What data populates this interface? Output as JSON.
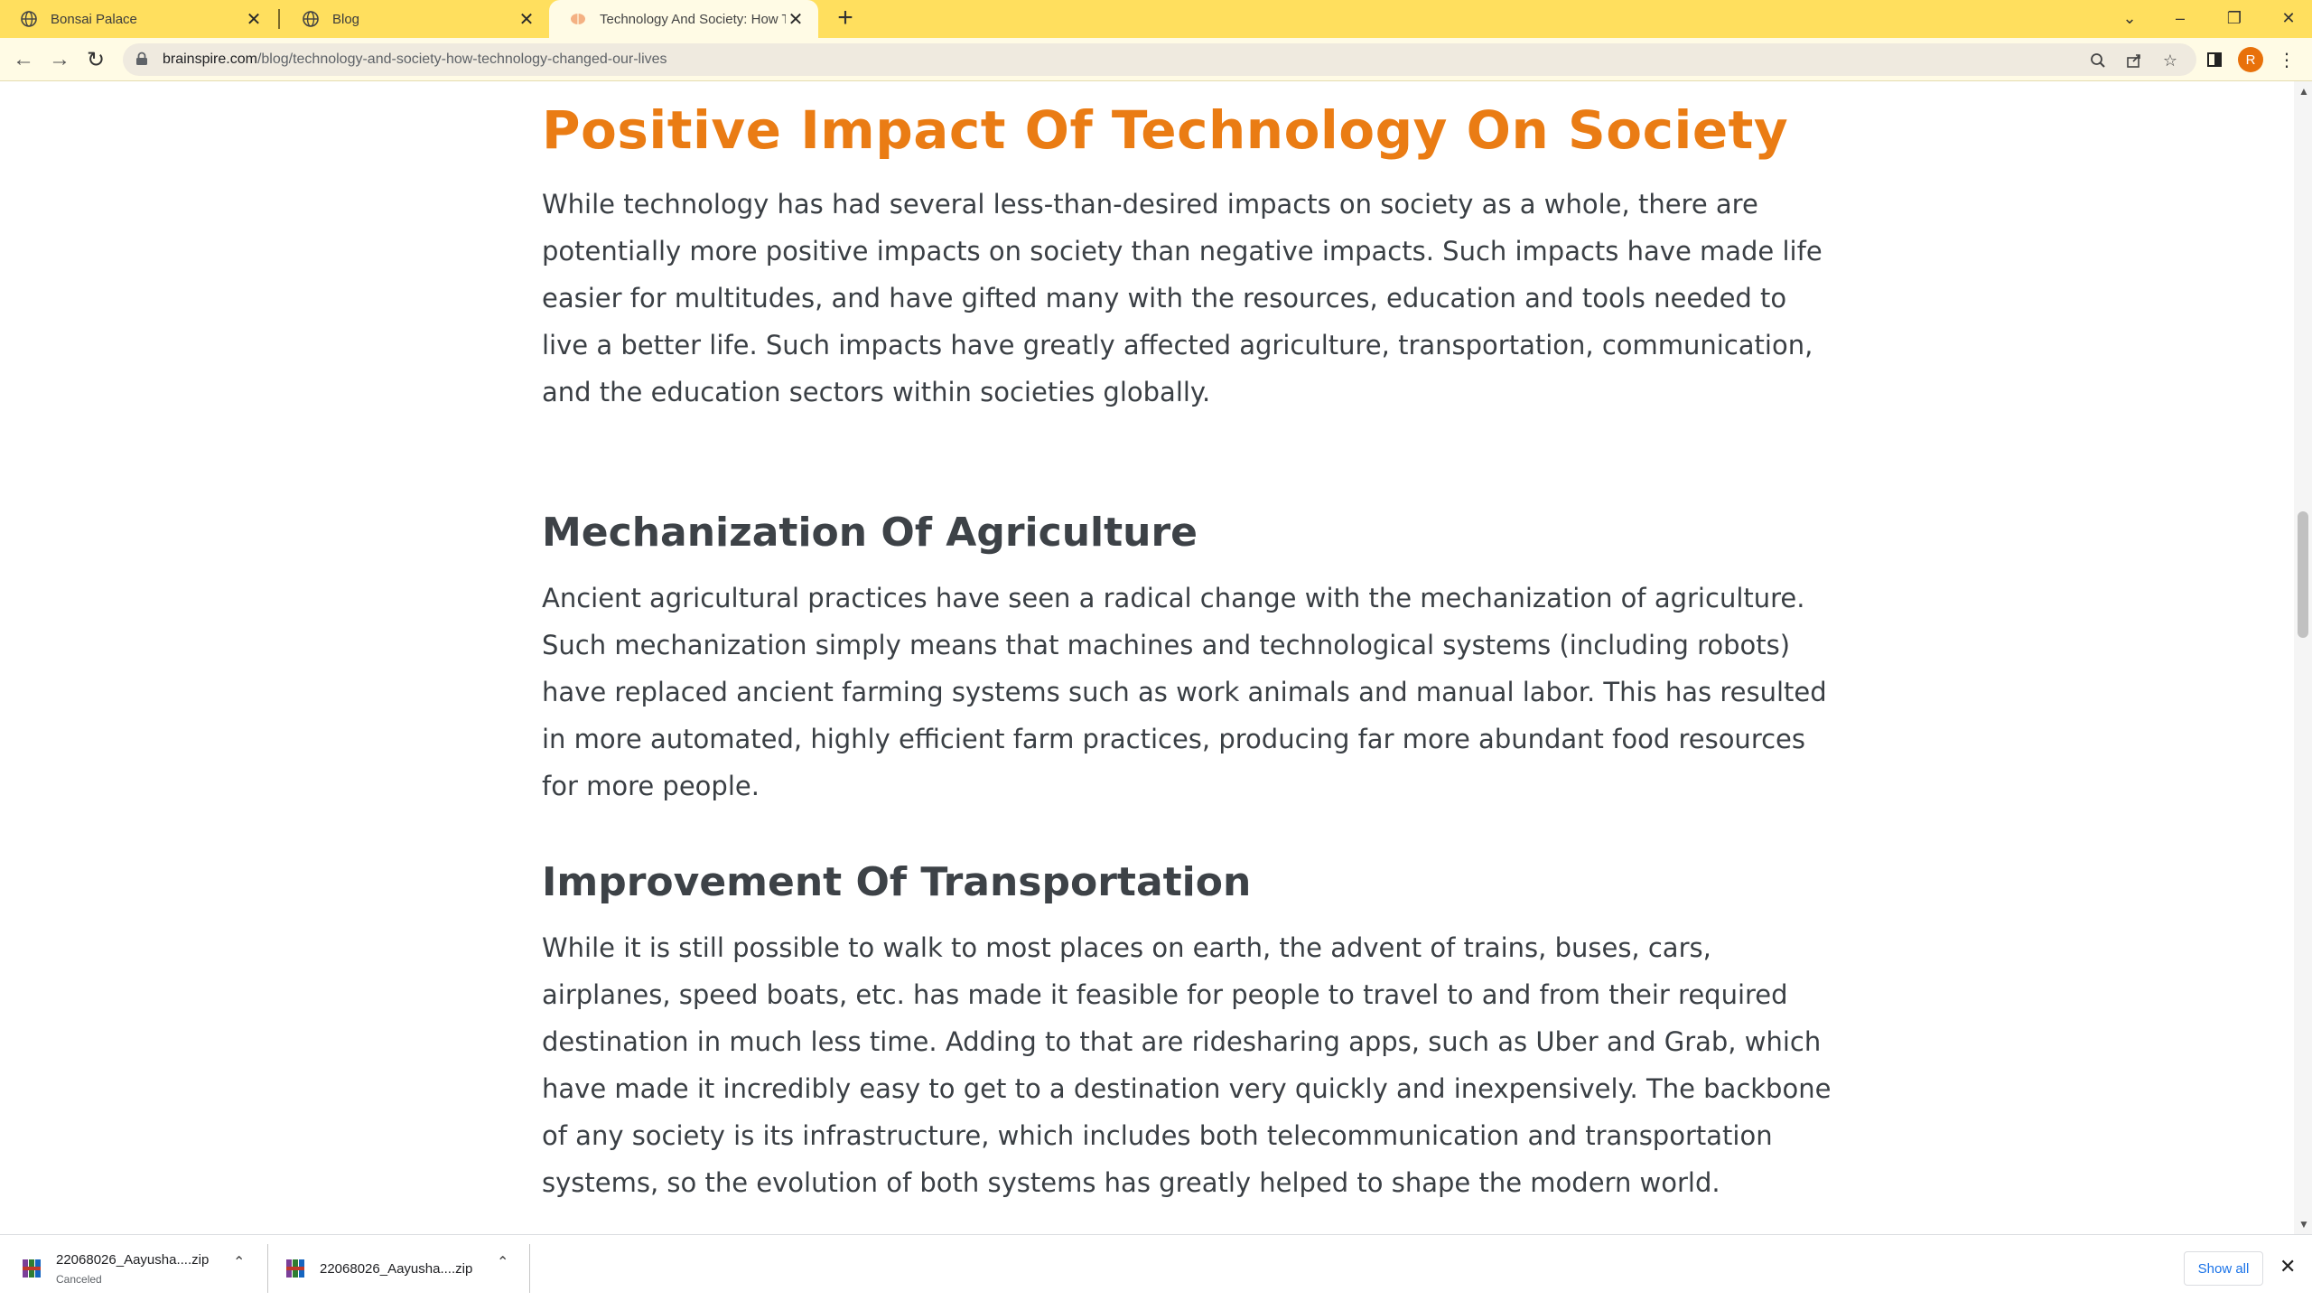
{
  "browser": {
    "tabs": [
      {
        "title": "Bonsai Palace",
        "icon": "globe-icon"
      },
      {
        "title": "Blog",
        "icon": "globe-icon"
      },
      {
        "title": "Technology And Society: How Te",
        "icon": "brain-icon",
        "active": true
      }
    ],
    "new_tab": "+",
    "window_controls": {
      "dropdown": "⌄",
      "minimize": "–",
      "restore": "❐",
      "close": "✕"
    },
    "nav": {
      "back": "←",
      "forward": "→",
      "reload": "↻"
    },
    "url_host": "brainspire.com",
    "url_path": "/blog/technology-and-society-how-technology-changed-our-lives",
    "avatar_letter": "R",
    "accent": "#ffdf5e"
  },
  "article": {
    "h1": "Positive Impact Of Technology On Society",
    "p1": "While technology has had several less-than-desired impacts on society as a whole, there are potentially more  positive impacts on society than negative impacts. Such impacts have made life easier for multitudes, and have gifted many with the resources, education and tools needed to live a better life. Such impacts have greatly affected agriculture, transportation, communication, and the education sectors within societies globally.",
    "h2_agri": "Mechanization Of Agriculture",
    "p_agri": "Ancient agricultural practices have seen a radical change with the mechanization of agriculture. Such mechanization simply means that machines and technological systems (including robots) have replaced ancient farming systems such as work animals and manual labor. This has resulted in more automated, highly efficient farm practices, producing far more abundant food resources for more people.",
    "h2_trans": "Improvement Of Transportation",
    "p_trans": "While it is still possible to walk to most places on earth, the advent of trains, buses, cars, airplanes, speed boats, etc. has made it feasible for people to travel to and from their required destination in much less time. Adding to that are ridesharing apps, such as Uber and Grab, which have made it incredibly easy to get to a destination very quickly and inexpensively. The backbone of any society is its infrastructure, which includes both telecommunication and transportation systems, so the evolution of both  systems has greatly helped to shape the modern world.",
    "heading_color": "#ea7c14"
  },
  "downloads": {
    "items": [
      {
        "name": "22068026_Aayusha....zip",
        "status": "Canceled"
      },
      {
        "name": "22068026_Aayusha....zip",
        "status": ""
      }
    ],
    "show_all": "Show all",
    "close": "✕"
  }
}
